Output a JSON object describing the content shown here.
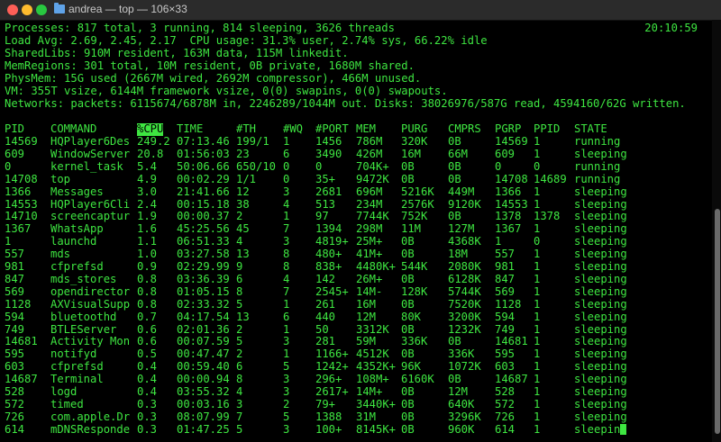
{
  "window": {
    "title": "andrea — top — 106×33"
  },
  "summary": {
    "processes": "Processes: 817 total, 3 running, 814 sleeping, 3626 threads",
    "clock": "20:10:59",
    "load": "Load Avg: 2.69, 2.45, 2.17  CPU usage: 31.3% user, 2.74% sys, 66.22% idle",
    "sharedlibs": "SharedLibs: 910M resident, 163M data, 115M linkedit.",
    "memregions": "MemRegions: 301 total, 10M resident, 0B private, 1680M shared.",
    "physmem": "PhysMem: 15G used (2667M wired, 2692M compressor), 466M unused.",
    "vm": "VM: 355T vsize, 6144M framework vsize, 0(0) swapins, 0(0) swapouts.",
    "networks": "Networks: packets: 6115674/6878M in, 2246289/1044M out. Disks: 38026976/587G read, 4594160/62G written."
  },
  "table": {
    "columns": [
      "PID",
      "COMMAND",
      "%CPU",
      "TIME",
      "#TH",
      "#WQ",
      "#PORT",
      "MEM",
      "PURG",
      "CMPRS",
      "PGRP",
      "PPID",
      "STATE"
    ],
    "highlighted_column": "%CPU",
    "rows": [
      [
        "14569",
        "HQPlayer6Des",
        "249.2",
        "07:13.46",
        "199/1",
        "1",
        "1456",
        "786M",
        "320K",
        "0B",
        "14569",
        "1",
        "running"
      ],
      [
        "609",
        "WindowServer",
        "20.8",
        "01:56:03",
        "23",
        "6",
        "3490",
        "426M",
        "16M",
        "66M",
        "609",
        "1",
        "sleeping"
      ],
      [
        "0",
        "kernel_task",
        "5.4",
        "50:06.66",
        "650/10",
        "0",
        "0",
        "704K+",
        "0B",
        "0B",
        "0",
        "0",
        "running"
      ],
      [
        "14708",
        "top",
        "4.9",
        "00:02.29",
        "1/1",
        "0",
        "35+",
        "9472K",
        "0B",
        "0B",
        "14708",
        "14689",
        "running"
      ],
      [
        "1366",
        "Messages",
        "3.0",
        "21:41.66",
        "12",
        "3",
        "2681",
        "696M",
        "5216K",
        "449M",
        "1366",
        "1",
        "sleeping"
      ],
      [
        "14553",
        "HQPlayer6Cli",
        "2.4",
        "00:15.18",
        "38",
        "4",
        "513",
        "234M",
        "2576K",
        "9120K",
        "14553",
        "1",
        "sleeping"
      ],
      [
        "14710",
        "screencaptur",
        "1.9",
        "00:00.37",
        "2",
        "1",
        "97",
        "7744K",
        "752K",
        "0B",
        "1378",
        "1378",
        "sleeping"
      ],
      [
        "1367",
        "WhatsApp",
        "1.6",
        "45:25.56",
        "45",
        "7",
        "1394",
        "298M",
        "11M",
        "127M",
        "1367",
        "1",
        "sleeping"
      ],
      [
        "1",
        "launchd",
        "1.1",
        "06:51.33",
        "4",
        "3",
        "4819+",
        "25M+",
        "0B",
        "4368K",
        "1",
        "0",
        "sleeping"
      ],
      [
        "557",
        "mds",
        "1.0",
        "03:27.58",
        "13",
        "8",
        "480+",
        "41M+",
        "0B",
        "18M",
        "557",
        "1",
        "sleeping"
      ],
      [
        "981",
        "cfprefsd",
        "0.9",
        "02:29.99",
        "9",
        "8",
        "838+",
        "4480K+",
        "544K",
        "2080K",
        "981",
        "1",
        "sleeping"
      ],
      [
        "847",
        "mds_stores",
        "0.8",
        "03:36.39",
        "6",
        "4",
        "142",
        "26M+",
        "0B",
        "6128K",
        "847",
        "1",
        "sleeping"
      ],
      [
        "569",
        "opendirector",
        "0.8",
        "01:05.15",
        "8",
        "7",
        "2545+",
        "14M-",
        "128K",
        "5744K",
        "569",
        "1",
        "sleeping"
      ],
      [
        "1128",
        "AXVisualSupp",
        "0.8",
        "02:33.32",
        "5",
        "1",
        "261",
        "16M",
        "0B",
        "7520K",
        "1128",
        "1",
        "sleeping"
      ],
      [
        "594",
        "bluetoothd",
        "0.7",
        "04:17.54",
        "13",
        "6",
        "440",
        "12M",
        "80K",
        "3200K",
        "594",
        "1",
        "sleeping"
      ],
      [
        "749",
        "BTLEServer",
        "0.6",
        "02:01.36",
        "2",
        "1",
        "50",
        "3312K",
        "0B",
        "1232K",
        "749",
        "1",
        "sleeping"
      ],
      [
        "14681",
        "Activity Mon",
        "0.6",
        "00:07.59",
        "5",
        "3",
        "281",
        "59M",
        "336K",
        "0B",
        "14681",
        "1",
        "sleeping"
      ],
      [
        "595",
        "notifyd",
        "0.5",
        "00:47.47",
        "2",
        "1",
        "1166+",
        "4512K",
        "0B",
        "336K",
        "595",
        "1",
        "sleeping"
      ],
      [
        "603",
        "cfprefsd",
        "0.4",
        "00:59.40",
        "6",
        "5",
        "1242+",
        "4352K+",
        "96K",
        "1072K",
        "603",
        "1",
        "sleeping"
      ],
      [
        "14687",
        "Terminal",
        "0.4",
        "00:00.94",
        "8",
        "3",
        "296+",
        "108M+",
        "6160K",
        "0B",
        "14687",
        "1",
        "sleeping"
      ],
      [
        "528",
        "logd",
        "0.4",
        "03:55.32",
        "4",
        "3",
        "2617+",
        "14M+",
        "0B",
        "12M",
        "528",
        "1",
        "sleeping"
      ],
      [
        "572",
        "timed",
        "0.3",
        "00:03.16",
        "3",
        "2",
        "79+",
        "3440K+",
        "0B",
        "640K",
        "572",
        "1",
        "sleeping"
      ],
      [
        "726",
        "com.apple.Dr",
        "0.3",
        "08:07.99",
        "7",
        "5",
        "1388",
        "31M",
        "0B",
        "3296K",
        "726",
        "1",
        "sleeping"
      ],
      [
        "614",
        "mDNSResponde",
        "0.3",
        "01:47.25",
        "5",
        "3",
        "100+",
        "8145K+",
        "0B",
        "960K",
        "614",
        "1",
        "sleepin"
      ]
    ]
  },
  "colors": {
    "text": "#3ee641",
    "background": "#000000"
  }
}
